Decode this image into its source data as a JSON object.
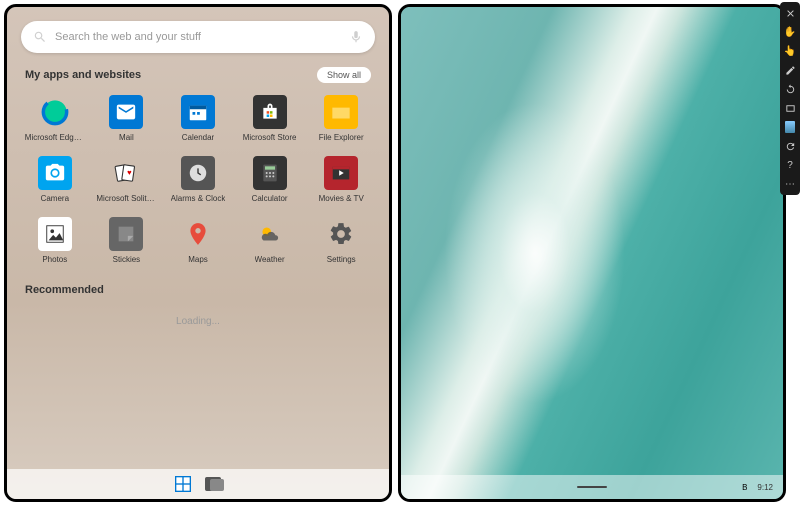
{
  "search": {
    "placeholder": "Search the web and your stuff"
  },
  "sections": {
    "apps_title": "My apps and websites",
    "show_all": "Show all",
    "recommended": "Recommended",
    "loading": "Loading..."
  },
  "apps": [
    {
      "label": "Microsoft Edge ...",
      "icon": "edge",
      "bg": "transparent"
    },
    {
      "label": "Mail",
      "icon": "mail",
      "bg": "#0078d4"
    },
    {
      "label": "Calendar",
      "icon": "calendar",
      "bg": "#0078d4"
    },
    {
      "label": "Microsoft Store",
      "icon": "store",
      "bg": "#333"
    },
    {
      "label": "File Explorer",
      "icon": "folder",
      "bg": "#ffb900"
    },
    {
      "label": "Camera",
      "icon": "camera",
      "bg": "#00a4ef"
    },
    {
      "label": "Microsoft Solita...",
      "icon": "cards",
      "bg": "transparent"
    },
    {
      "label": "Alarms & Clock",
      "icon": "clock",
      "bg": "#555"
    },
    {
      "label": "Calculator",
      "icon": "calc",
      "bg": "#333"
    },
    {
      "label": "Movies & TV",
      "icon": "movie",
      "bg": "#b5252d"
    },
    {
      "label": "Photos",
      "icon": "photos",
      "bg": "#fff"
    },
    {
      "label": "Stickies",
      "icon": "sticky",
      "bg": "#666"
    },
    {
      "label": "Maps",
      "icon": "pin",
      "bg": "transparent"
    },
    {
      "label": "Weather",
      "icon": "weather",
      "bg": "transparent"
    },
    {
      "label": "Settings",
      "icon": "gear",
      "bg": "transparent"
    }
  ],
  "taskbar_right": {
    "time": "9:12",
    "battery": "B"
  },
  "sidebar_icons": [
    "close",
    "hand",
    "hand2",
    "pencil",
    "rotate",
    "rect",
    "device",
    "refresh",
    "help",
    "more"
  ]
}
